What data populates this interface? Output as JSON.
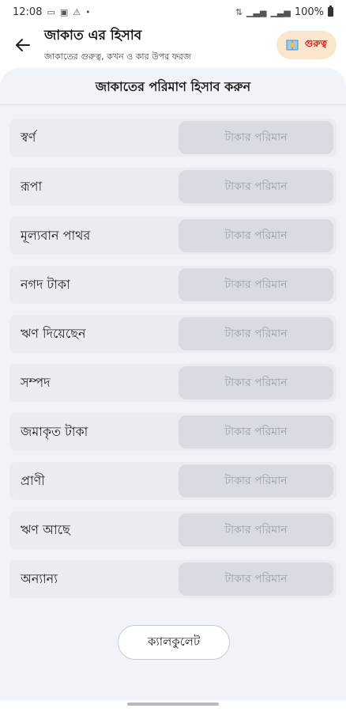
{
  "status_bar": {
    "time": "12:08",
    "battery": "100%"
  },
  "app_bar": {
    "title": "জাকাত এর হিসাব",
    "subtitle": "জাকাতের গুরুত্ব, কখন ও কার উপর ফরজ",
    "important_label": "গুরুত্ব"
  },
  "calculator": {
    "heading": "জাকাতের পরিমাণ হিসাব করুন",
    "input_placeholder": "টাকার পরিমান",
    "items": [
      {
        "label": "স্বর্ণ",
        "value": ""
      },
      {
        "label": "রূপা",
        "value": ""
      },
      {
        "label": "মূল্যবান পাথর",
        "value": ""
      },
      {
        "label": "নগদ টাকা",
        "value": ""
      },
      {
        "label": "ঋণ দিয়েছেন",
        "value": ""
      },
      {
        "label": "সম্পদ",
        "value": ""
      },
      {
        "label": "জমাকৃত টাকা",
        "value": ""
      },
      {
        "label": "প্রাণী",
        "value": ""
      },
      {
        "label": "ঋণ আছে",
        "value": ""
      },
      {
        "label": "অন্যান্য",
        "value": ""
      }
    ],
    "calculate_label": "ক্যালকুলেট"
  },
  "colors": {
    "accent_red": "#d32020",
    "badge_bg": "#fbe7cc",
    "panel_bg": "#f0f3f7",
    "input_bg": "#d8dce2"
  }
}
